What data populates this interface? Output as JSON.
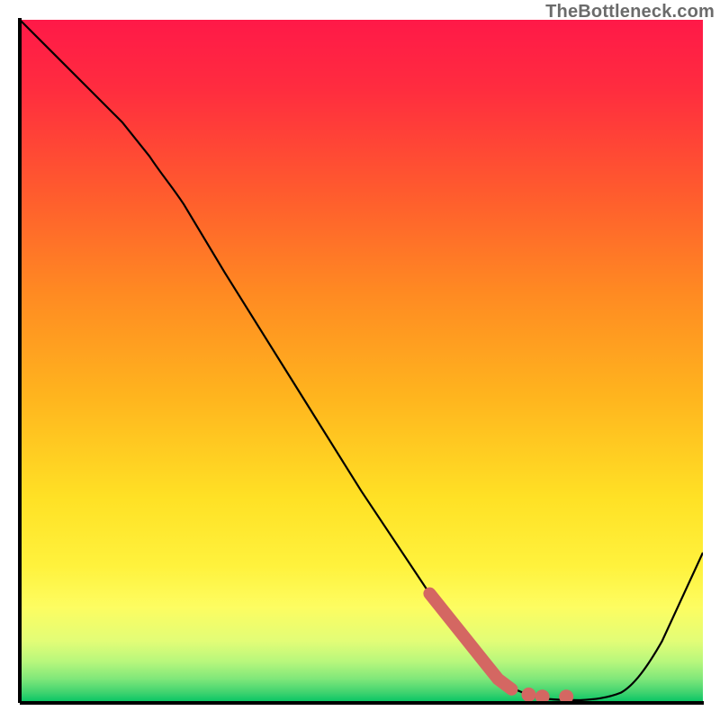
{
  "attribution": "TheBottleneck.com",
  "chart_data": {
    "type": "line",
    "title": "",
    "xlabel": "",
    "ylabel": "",
    "xlim": [
      0,
      100
    ],
    "ylim": [
      0,
      100
    ],
    "series": [
      {
        "name": "curve",
        "x": [
          0,
          5,
          10,
          15,
          19,
          22,
          30,
          40,
          50,
          60,
          65,
          68,
          72,
          75,
          78,
          82,
          86,
          90,
          94,
          100
        ],
        "y": [
          100,
          95,
          90,
          85,
          80,
          76,
          63,
          47,
          31,
          16,
          9,
          5,
          2,
          1,
          0.6,
          0.4,
          0.6,
          3,
          9,
          22
        ]
      }
    ],
    "highlight_segment": {
      "name": "emphasized-points",
      "x": [
        60,
        62,
        64,
        66,
        68,
        70,
        74,
        78,
        80
      ],
      "y": [
        16,
        13.5,
        11,
        8.5,
        6,
        3.5,
        1.5,
        1,
        1
      ]
    },
    "colors": {
      "gradient_stops": [
        {
          "offset": 0.0,
          "color": "#ff1948"
        },
        {
          "offset": 0.1,
          "color": "#ff2c3f"
        },
        {
          "offset": 0.25,
          "color": "#ff5a2e"
        },
        {
          "offset": 0.4,
          "color": "#ff8a22"
        },
        {
          "offset": 0.55,
          "color": "#ffb41e"
        },
        {
          "offset": 0.7,
          "color": "#ffe125"
        },
        {
          "offset": 0.8,
          "color": "#fff23d"
        },
        {
          "offset": 0.86,
          "color": "#fdfd61"
        },
        {
          "offset": 0.91,
          "color": "#e2fd77"
        },
        {
          "offset": 0.94,
          "color": "#b7f77c"
        },
        {
          "offset": 0.965,
          "color": "#7fe77a"
        },
        {
          "offset": 0.985,
          "color": "#3fd36f"
        },
        {
          "offset": 1.0,
          "color": "#00c463"
        }
      ],
      "curve_stroke": "#000000",
      "highlight": "#d46762",
      "axes": "#000000"
    }
  }
}
